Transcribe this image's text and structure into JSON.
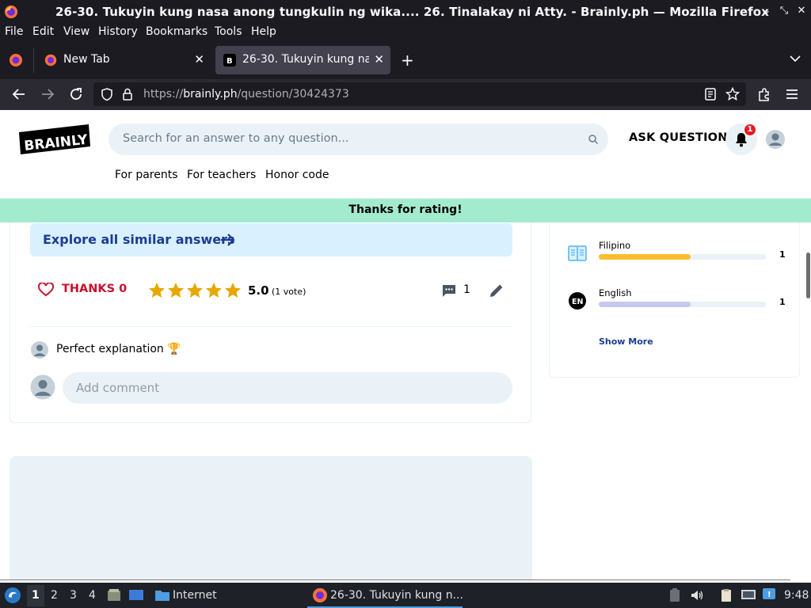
{
  "window": {
    "title": "26-30. Tukuyin kung nasa anong tungkulin ng wika.... 26. Tinalakay ni Atty. - Brainly.ph — Mozilla Firefox"
  },
  "menu": {
    "items": [
      "File",
      "Edit",
      "View",
      "History",
      "Bookmarks",
      "Tools",
      "Help"
    ]
  },
  "tabs": [
    {
      "label": "New Tab",
      "active": false
    },
    {
      "label": "26-30. Tukuyin kung nasa",
      "active": true
    }
  ],
  "navbar": {
    "url_prefix": "https://",
    "url_host": "brainly.ph",
    "url_path": "/question/30424373"
  },
  "site": {
    "logo_text": "BRAINLY",
    "search_placeholder": "Search for an answer to any question...",
    "ask_label": "ASK QUESTION",
    "notification_count": "1",
    "subnav": [
      "For parents",
      "For teachers",
      "Honor code"
    ]
  },
  "toast": {
    "text": "Thanks for rating!"
  },
  "answer": {
    "explore_label": "Explore all similar answers",
    "thanks_label": "THANKS 0",
    "rating": "5.0",
    "votes": "(1 vote)",
    "comment_count": "1",
    "stars": 5,
    "comment_text": "Perfect explanation 🏆",
    "add_comment_placeholder": "Add comment"
  },
  "sidebar": {
    "subjects": [
      {
        "name": "Filipino",
        "count": "1",
        "color": "#fbbe2e",
        "fill": 0.55,
        "icon": "book-icon"
      },
      {
        "name": "English",
        "count": "1",
        "color": "#c7c9f0",
        "fill": 0.55,
        "icon": "en-badge-icon",
        "icon_text": "EN"
      }
    ],
    "show_more": "Show More"
  },
  "taskbar": {
    "workspaces": [
      "1",
      "2",
      "3",
      "4"
    ],
    "current_workspace": "1",
    "launcher_label": "Internet",
    "task_label": "26-30. Tukuyin kung n...",
    "clock": "9:48"
  },
  "colors": {
    "brainly_blue": "#1c3c93",
    "thanks_red": "#c8102e",
    "star_gold": "#e6a800",
    "toast_green": "#a3ebcf"
  }
}
